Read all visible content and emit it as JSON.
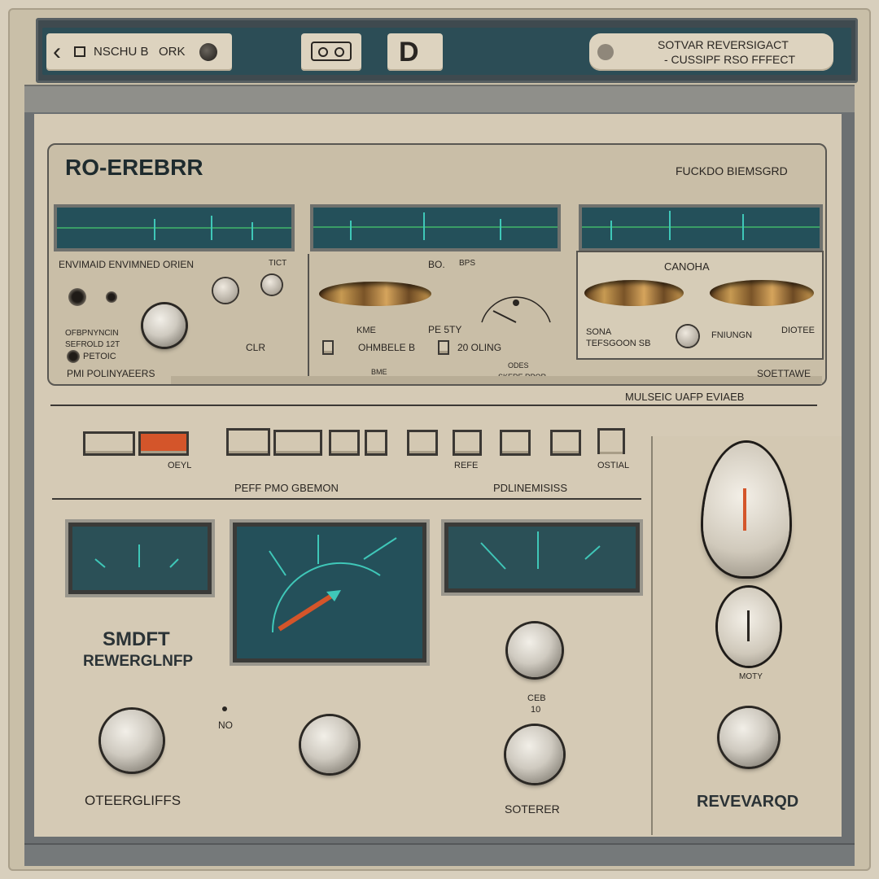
{
  "topbar": {
    "nav_label": "NSCHU B",
    "nav_sub": "ORK",
    "center_logo": "D",
    "title_line1": "SOTVAR REVERSIGACT",
    "title_line2": "- CUSSIPF RSO FFFECT"
  },
  "reverb": {
    "name": "RO-EREBRR",
    "brand": "FUCKDO BIEMSGRD",
    "section1": {
      "label": "ENVIMAID ENVIMNED ORIEN",
      "tag": "TICT",
      "lines": [
        "OFBPNYNCIN",
        "SEFROLD 12T",
        "PETOIC"
      ],
      "footer": "PMI POLINYAEERS",
      "clr": "CLR"
    },
    "section2": {
      "label_left": "BO.",
      "label_right": "BPS",
      "row1": [
        "KME",
        "PE 5TY"
      ],
      "row2": [
        "OHMBELE B",
        "20 OLING"
      ],
      "extra": [
        "BME",
        "ODES",
        "SKERE RPOR"
      ]
    },
    "section3": {
      "label": "CANOHA",
      "left": "SONA",
      "left2": "TEFSGOON SB",
      "mid": "FNIUNGN",
      "right": "DIOTEE"
    },
    "bottom_tag": "SOETTAWE"
  },
  "strip_label": "MULSEIC UAFP EVIAEB",
  "buttons": {
    "group1_label": "OEYL",
    "group2_label": "PEFF PMO GBEMON",
    "group3_label": "REFE",
    "group4_label": "PDLINEMISISS",
    "group5_label": "OSTIAL"
  },
  "lower": {
    "left_title1": "SMDFT",
    "left_title2": "REWERGLNFP",
    "knob1_label": "OTEERGLIFFS",
    "no_label": "NO",
    "knob3_label": "SOTERER",
    "knob3_top": "CEB",
    "knob3_top2": "10",
    "right_small": "MOTY",
    "right_label": "REVEVARQD"
  },
  "colors": {
    "panel": "#d5cab5",
    "screen": "#24505a",
    "accent": "#d4552a",
    "trace": "#3fc7b8"
  }
}
